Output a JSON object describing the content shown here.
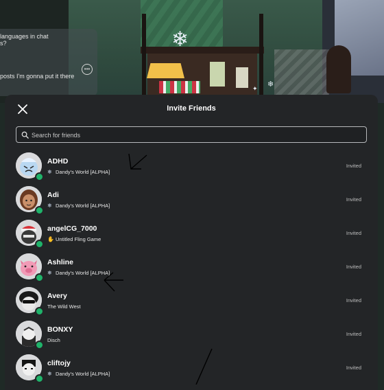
{
  "chat": {
    "lines": [
      "languages in chat",
      "s?",
      "posts  I'm gonna put it there"
    ]
  },
  "panel": {
    "title": "Invite Friends",
    "search_placeholder": "Search for friends"
  },
  "friends": [
    {
      "name": "ADHD",
      "game": "Dandy's World [ALPHA]",
      "game_icon": "snowflake",
      "status": "Invited"
    },
    {
      "name": "Adi",
      "game": "Dandy's World [ALPHA]",
      "game_icon": "snowflake",
      "status": "Invited"
    },
    {
      "name": "angelCG_7000",
      "game": "Untitled Fling Game",
      "game_icon": "hand",
      "status": "Invited"
    },
    {
      "name": "Ashline",
      "game": "Dandy's World [ALPHA]",
      "game_icon": "snowflake",
      "status": "Invited"
    },
    {
      "name": "Avery",
      "game": "The Wild West",
      "game_icon": "",
      "status": "Invited"
    },
    {
      "name": "BONXY",
      "game": "Disch",
      "game_icon": "",
      "status": "Invited"
    },
    {
      "name": "cliftojy",
      "game": "Dandy's World [ALPHA]",
      "game_icon": "snowflake",
      "status": "Invited"
    }
  ],
  "colors": {
    "panel_bg": "#232527",
    "online": "#1fb36a",
    "text": "#ffffff",
    "muted": "#bdbdbd"
  }
}
